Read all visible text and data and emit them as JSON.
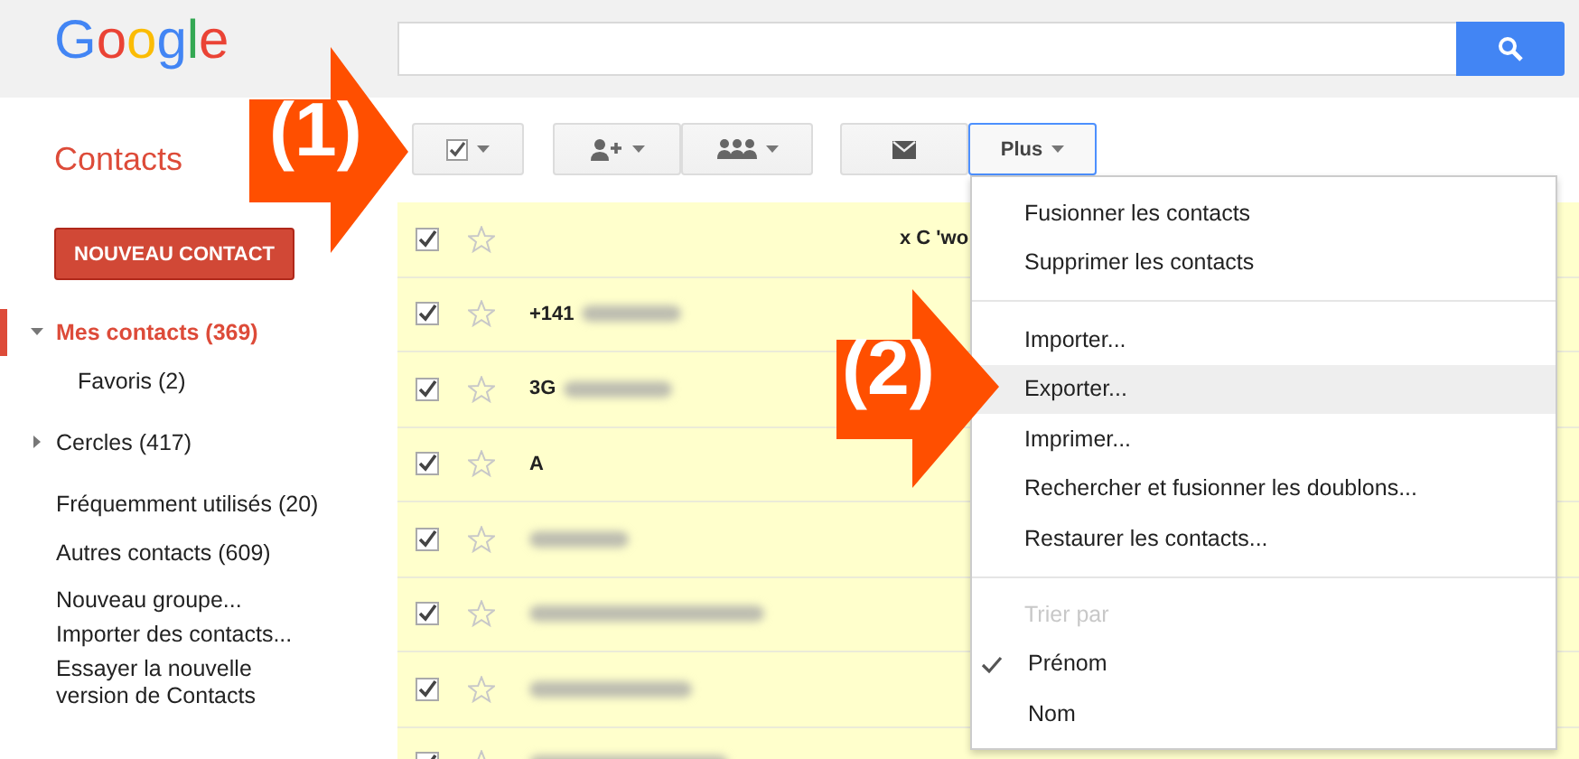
{
  "header": {
    "logo": "Google"
  },
  "app_title": "Contacts",
  "toolbar": [
    {
      "kind": "select"
    },
    {
      "kind": "add-person"
    },
    {
      "kind": "group"
    },
    {
      "kind": "mail"
    },
    {
      "kind": "text",
      "label": "Plus",
      "expanded": true
    }
  ],
  "sidebar": {
    "new_contact_button": "NOUVEAU CONTACT",
    "items": [
      {
        "label": "Mes contacts (369)",
        "selected": true,
        "expanded": true,
        "children": [
          {
            "label": "Favoris (2)",
            "selected": false
          }
        ]
      },
      {
        "label": "Cercles (417)",
        "selected": false,
        "expanded": false
      },
      {
        "label": "Fréquemment utilisés (20)",
        "selected": false
      },
      {
        "label": "Autres contacts (609)",
        "selected": false
      }
    ],
    "links": [
      "Nouveau groupe...",
      "Importer des contacts...",
      "Essayer la nouvelle version de Contacts"
    ]
  },
  "contacts": [
    {
      "checked": true,
      "starred": false,
      "blurred": false,
      "column_3": "x C 'wo"
    },
    {
      "name": "+141",
      "checked": true,
      "starred": false,
      "blurred": true
    },
    {
      "name": "3G",
      "checked": true,
      "starred": false,
      "blurred": true
    },
    {
      "name": "A",
      "checked": true,
      "starred": false,
      "blurred": false
    },
    {
      "checked": true,
      "starred": false,
      "blurred": true
    },
    {
      "checked": true,
      "starred": false,
      "blurred": true
    },
    {
      "checked": true,
      "starred": false,
      "blurred": true
    },
    {
      "checked": true,
      "starred": false,
      "blurred": true
    }
  ],
  "menu": {
    "sections": [
      {
        "items": [
          {
            "label": "Fusionner les contacts",
            "selected": false
          },
          {
            "label": "Supprimer les contacts",
            "selected": false
          }
        ]
      },
      {
        "items": [
          {
            "label": "Importer...",
            "selected": false
          },
          {
            "label": "Exporter...",
            "selected": true
          },
          {
            "label": "Imprimer...",
            "selected": false
          },
          {
            "label": "Rechercher et fusionner les doublons...",
            "selected": false
          },
          {
            "label": "Restaurer les contacts...",
            "selected": false
          }
        ]
      },
      {
        "heading": "Trier par",
        "items": [
          {
            "label": "Prénom",
            "selected": false,
            "checked": true
          },
          {
            "label": "Nom",
            "selected": false,
            "checked": false
          }
        ]
      }
    ]
  },
  "callouts": [
    {
      "label": "(1)"
    },
    {
      "label": "(2)"
    }
  ]
}
